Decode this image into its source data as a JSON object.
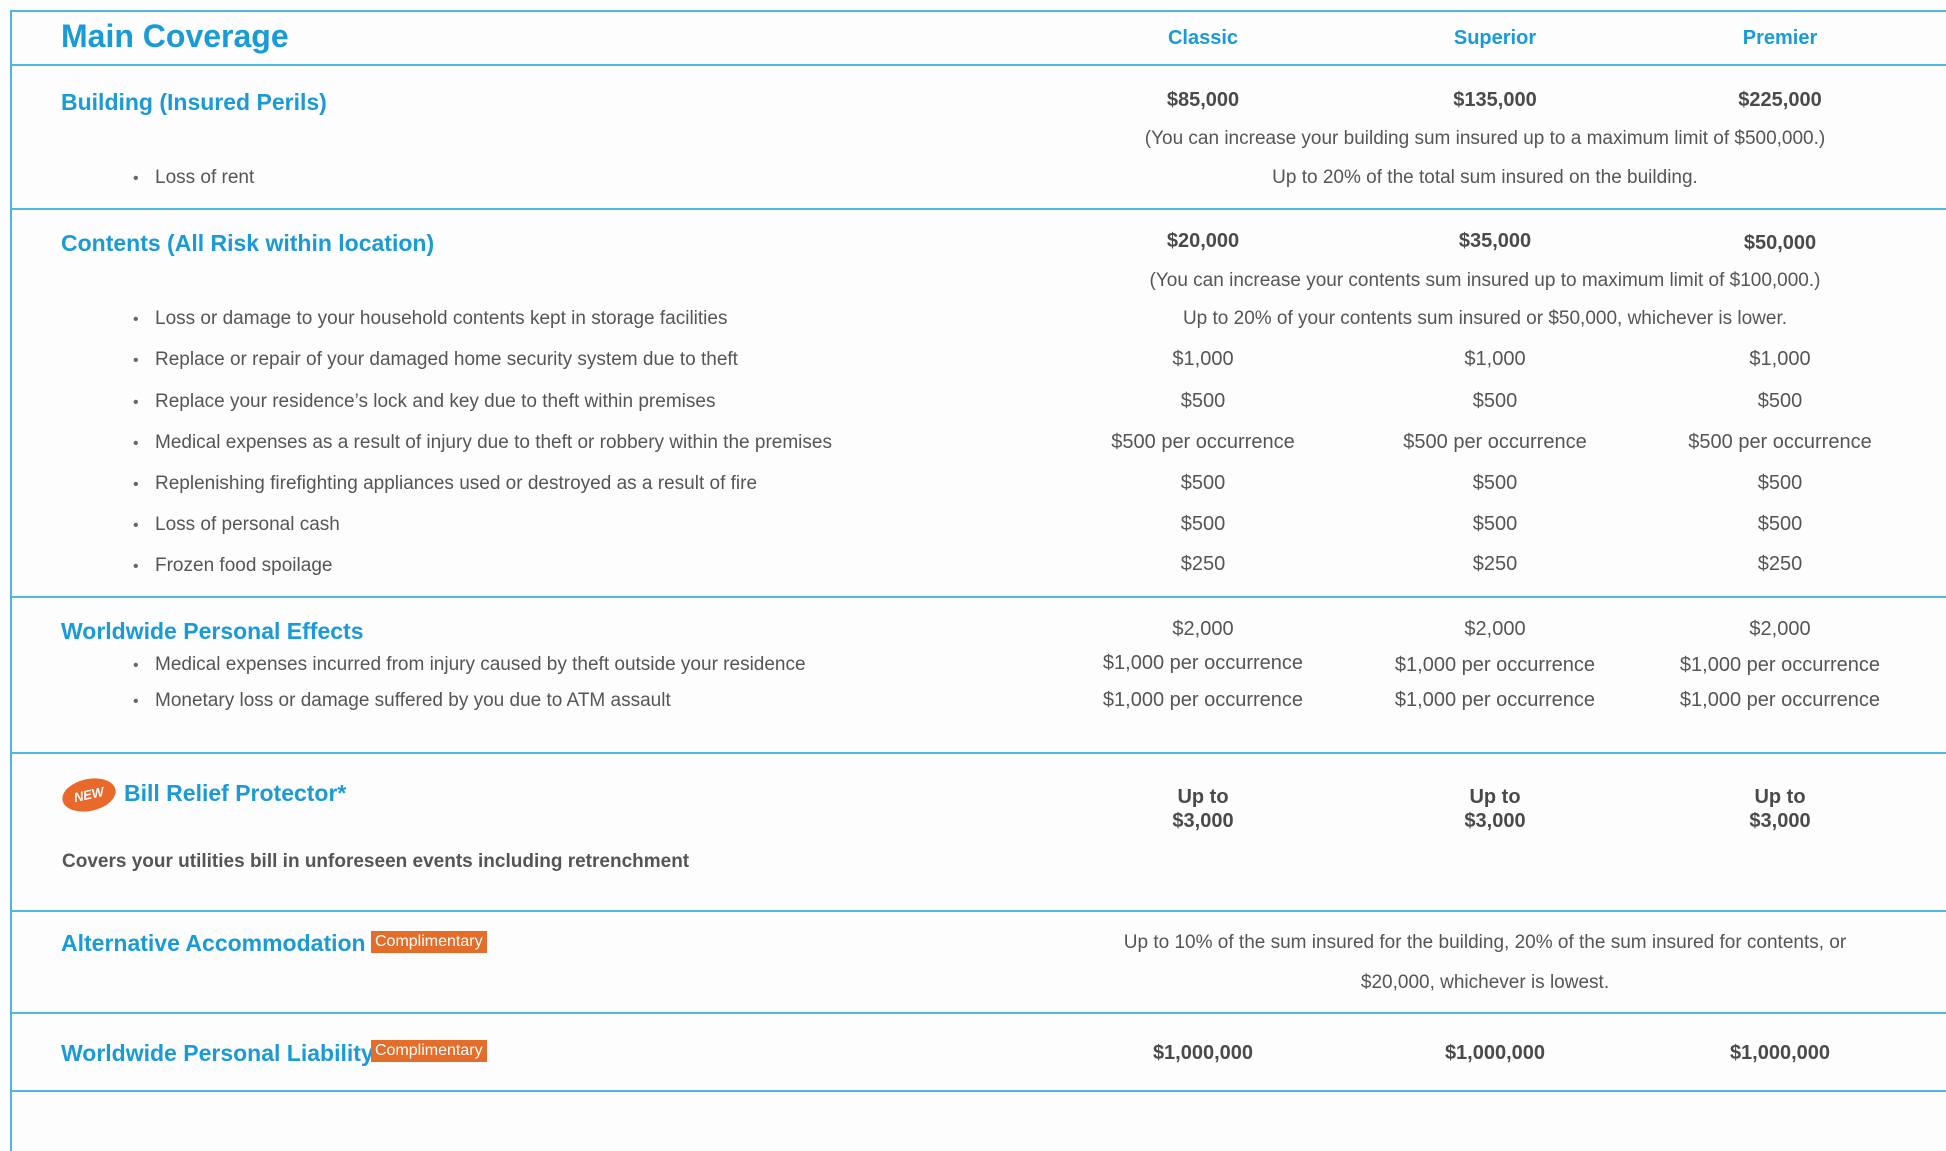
{
  "header": {
    "title": "Main Coverage",
    "columns": [
      "Classic",
      "Superior",
      "Premier"
    ]
  },
  "building": {
    "title": "Building (Insured Perils)",
    "values": [
      "$85,000",
      "$135,000",
      "$225,000"
    ],
    "note": "(You can increase your building sum insured up to a maximum limit of $500,000.)",
    "items": [
      {
        "label": "Loss of rent",
        "wide": "Up to 20% of the total sum insured on the building."
      }
    ]
  },
  "contents": {
    "title": "Contents (All Risk within location)",
    "values": [
      "$20,000",
      "$35,000",
      "$50,000"
    ],
    "note": "(You can increase your contents sum insured up to maximum limit of $100,000.)",
    "storage": {
      "label": "Loss or damage to your household contents kept in storage facilities",
      "wide": "Up to 20% of your contents sum insured or $50,000, whichever is lower."
    },
    "items": [
      {
        "label": "Replace or repair of your damaged home security system due to theft",
        "values": [
          "$1,000",
          "$1,000",
          "$1,000"
        ]
      },
      {
        "label": "Replace your residence’s lock and key due to theft within premises",
        "values": [
          "$500",
          "$500",
          "$500"
        ]
      },
      {
        "label": "Medical expenses as a result of injury due to theft or robbery within the premises",
        "values": [
          "$500 per occurrence",
          "$500 per occurrence",
          "$500 per occurrence"
        ]
      },
      {
        "label": "Replenishing firefighting appliances used or destroyed as a result of fire",
        "values": [
          "$500",
          "$500",
          "$500"
        ]
      },
      {
        "label": "Loss of personal cash",
        "values": [
          "$500",
          "$500",
          "$500"
        ]
      },
      {
        "label": "Frozen food spoilage",
        "values": [
          "$250",
          "$250",
          "$250"
        ]
      }
    ]
  },
  "effects": {
    "title": "Worldwide Personal Effects",
    "values": [
      "$2,000",
      "$2,000",
      "$2,000"
    ],
    "items": [
      {
        "label": "Medical expenses incurred from injury caused by theft outside your residence",
        "values": [
          "$1,000 per occurrence",
          "$1,000 per occurrence",
          "$1,000 per occurrence"
        ]
      },
      {
        "label": "Monetary loss or damage suffered by you due to ATM assault",
        "values": [
          "$1,000 per occurrence",
          "$1,000 per occurrence",
          "$1,000 per occurrence"
        ]
      }
    ]
  },
  "bill": {
    "badge": "NEW",
    "title": "Bill Relief Protector*",
    "values_line1": [
      "Up to",
      "Up to",
      "Up to"
    ],
    "values_line2": [
      "$3,000",
      "$3,000",
      "$3,000"
    ],
    "description": "Covers your utilities bill in unforeseen events including retrenchment"
  },
  "accommodation": {
    "title": "Alternative Accommodation",
    "tag": "Complimentary",
    "wide_line1": "Up to 10% of the sum insured for the building, 20% of the sum insured for contents, or",
    "wide_line2": "$20,000, whichever is lowest."
  },
  "liability": {
    "title": "Worldwide Personal Liability",
    "tag": "Complimentary",
    "values": [
      "$1,000,000",
      "$1,000,000",
      "$1,000,000"
    ]
  },
  "colors": {
    "accent": "#1a9ad6",
    "rule": "#4eb7e2",
    "tag": "#e56d2a"
  }
}
